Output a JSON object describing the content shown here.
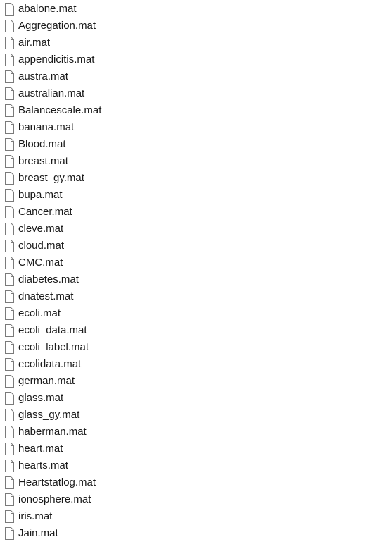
{
  "file_list": {
    "icon": "blank-file-icon",
    "items": [
      "abalone.mat",
      "Aggregation.mat",
      "air.mat",
      "appendicitis.mat",
      "austra.mat",
      "australian.mat",
      "Balancescale.mat",
      "banana.mat",
      "Blood.mat",
      "breast.mat",
      "breast_gy.mat",
      "bupa.mat",
      "Cancer.mat",
      "cleve.mat",
      "cloud.mat",
      "CMC.mat",
      "diabetes.mat",
      "dnatest.mat",
      "ecoli.mat",
      "ecoli_data.mat",
      "ecoli_label.mat",
      "ecolidata.mat",
      "german.mat",
      "glass.mat",
      "glass_gy.mat",
      "haberman.mat",
      "heart.mat",
      "hearts.mat",
      "Heartstatlog.mat",
      "ionosphere.mat",
      "iris.mat",
      "Jain.mat"
    ]
  }
}
